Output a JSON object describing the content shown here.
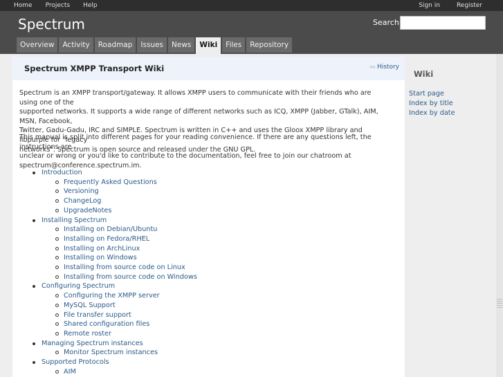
{
  "top_menu": {
    "left": [
      "Home",
      "Projects",
      "Help"
    ],
    "right": [
      "Sign in",
      "Register"
    ]
  },
  "header": {
    "title": "Spectrum",
    "search_label": "Search:",
    "search_value": ""
  },
  "tabs": [
    {
      "label": "Overview",
      "selected": false
    },
    {
      "label": "Activity",
      "selected": false
    },
    {
      "label": "Roadmap",
      "selected": false
    },
    {
      "label": "Issues",
      "selected": false
    },
    {
      "label": "News",
      "selected": false
    },
    {
      "label": "Wiki",
      "selected": true
    },
    {
      "label": "Files",
      "selected": false
    },
    {
      "label": "Repository",
      "selected": false
    }
  ],
  "content": {
    "title": "Spectrum XMPP Transport Wiki",
    "history_label": "History",
    "history_icon": "history-icon",
    "intro_lines": [
      "Spectrum is an XMPP transport/gateway. It allows XMPP users to communicate with their friends who are using one of the",
      "supported networks. It supports a wide range of different networks such as ICQ, XMPP (Jabber, GTalk), AIM, MSN, Facebook,",
      "Twitter, Gadu-Gadu, IRC and SIMPLE. Spectrum is written in C++ and uses the Gloox XMPP library and libpurple for \"legacy",
      "networks\". Spectrum is open source and released under the GNU GPL."
    ],
    "manual_lines": [
      "This manual is split into different pages for your reading convenience. If there are any questions left, the instructions are",
      "unclear or wrong or you'd like to contribute to the documentation, feel free to join our chatroom at",
      "spectrum@conference.spectrum.im."
    ],
    "toc": [
      {
        "label": "Introduction",
        "children": [
          "Frequently Asked Questions",
          "Versioning",
          "ChangeLog",
          "UpgradeNotes"
        ]
      },
      {
        "label": "Installing Spectrum",
        "children": [
          "Installing on Debian/Ubuntu",
          "Installing on Fedora/RHEL",
          "Installing on ArchLinux",
          "Installing on Windows",
          "Installing from source code on Linux",
          "Installing from source code on Windows"
        ]
      },
      {
        "label": "Configuring Spectrum",
        "children": [
          "Configuring the XMPP server",
          "MySQL Support",
          "File transfer support",
          "Shared configuration files",
          "Remote roster"
        ]
      },
      {
        "label": "Managing Spectrum instances",
        "children": [
          "Monitor Spectrum instances"
        ]
      },
      {
        "label": "Supported Protocols",
        "children": [
          "AIM"
        ]
      }
    ]
  },
  "sidebar": {
    "title": "Wiki",
    "links": [
      "Start page",
      "Index by title",
      "Index by date"
    ]
  }
}
